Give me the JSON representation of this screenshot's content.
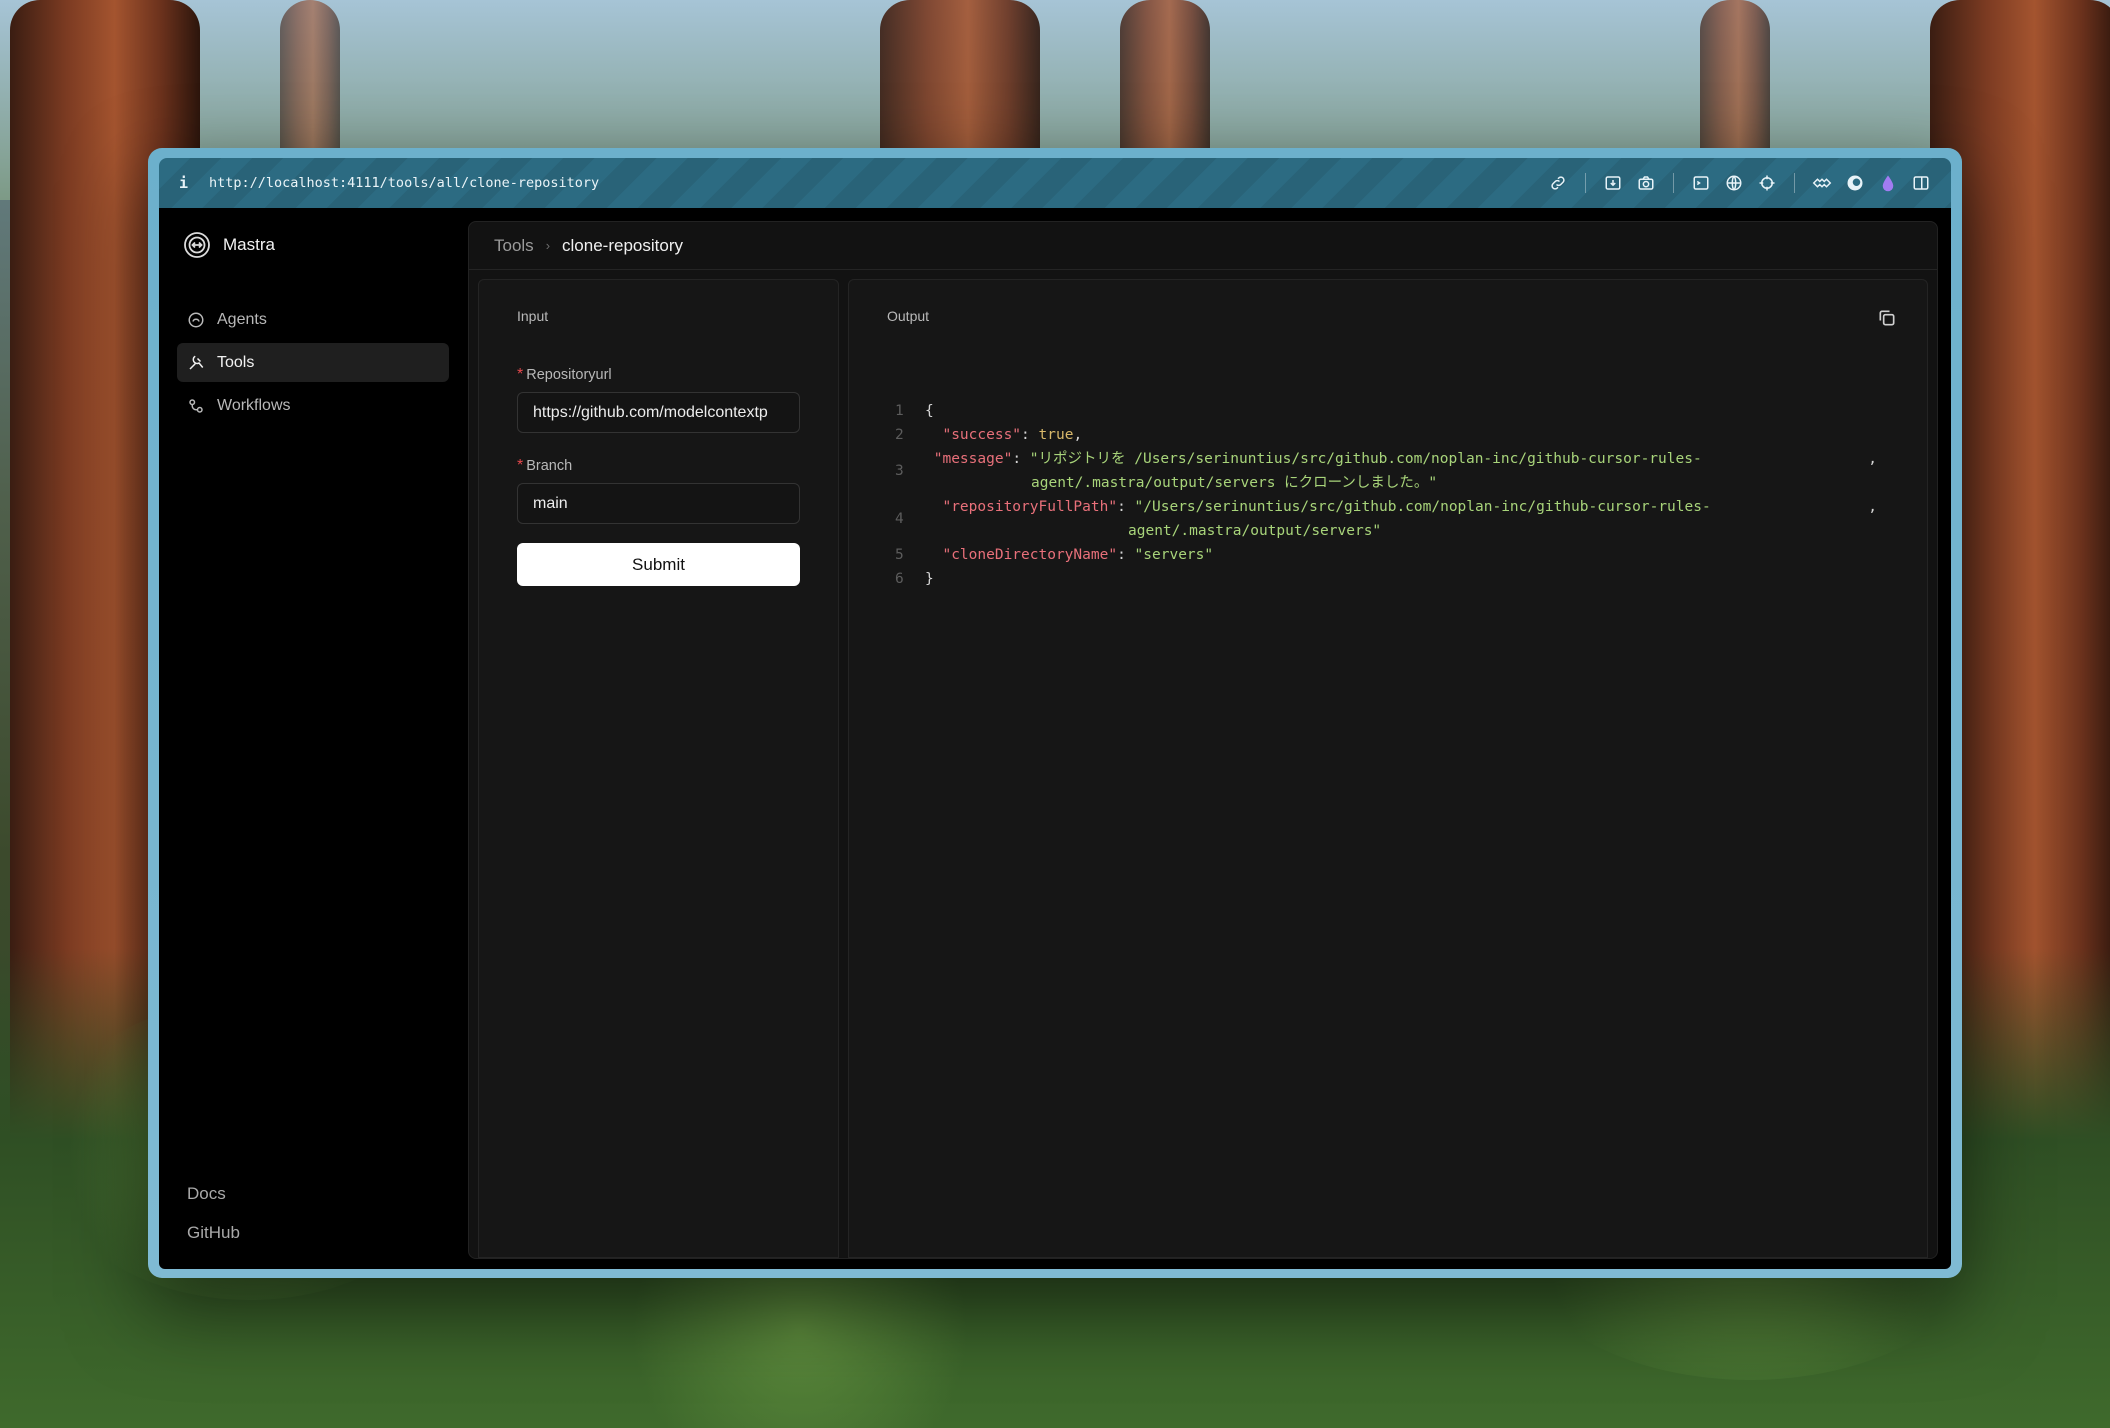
{
  "browser": {
    "url": "http://localhost:4111/tools/all/clone-repository",
    "info_icon": "i",
    "toolbar_icons": [
      "link-icon",
      "download-icon",
      "camera-icon",
      "terminal-icon",
      "globe-icon",
      "crosshair-icon",
      "extension-icon",
      "profile-icon",
      "purple-drop-icon",
      "split-view-icon"
    ]
  },
  "sidebar": {
    "brand": "Mastra",
    "items": [
      {
        "label": "Agents",
        "icon": "agents-icon",
        "active": false
      },
      {
        "label": "Tools",
        "icon": "tools-icon",
        "active": true
      },
      {
        "label": "Workflows",
        "icon": "workflows-icon",
        "active": false
      }
    ],
    "footer": {
      "docs": "Docs",
      "github": "GitHub"
    }
  },
  "breadcrumb": {
    "section": "Tools",
    "separator": "›",
    "current": "clone-repository"
  },
  "input_panel": {
    "title": "Input",
    "fields": [
      {
        "label": "Repositoryurl",
        "required_mark": "*",
        "value": "https://github.com/modelcontextp"
      },
      {
        "label": "Branch",
        "required_mark": "*",
        "value": "main"
      }
    ],
    "submit_label": "Submit"
  },
  "output_panel": {
    "title": "Output",
    "line_numbers": [
      "1",
      "2",
      "3",
      "4",
      "5",
      "6"
    ],
    "code": {
      "open": "{",
      "close": "}",
      "success_key": "\"success\"",
      "success_value": "true",
      "message_key": "\"message\"",
      "message_value_1": "\"リポジトリを /Users/serinuntius/src/github.com/noplan-inc/github-cursor-rules-",
      "message_value_2": "agent/.mastra/output/servers にクローンしました。\"",
      "path_key": "\"repositoryFullPath\"",
      "path_value_1": "\"/Users/serinuntius/src/github.com/noplan-inc/github-cursor-rules-",
      "path_value_2": "agent/.mastra/output/servers\"",
      "dir_key": "\"cloneDirectoryName\"",
      "dir_value": "\"servers\"",
      "colon": ": ",
      "comma": ","
    }
  },
  "colors": {
    "accent_required": "#e5484d",
    "json_key": "#e8707a",
    "json_string": "#a8d47a",
    "json_bool": "#d8b86a"
  }
}
